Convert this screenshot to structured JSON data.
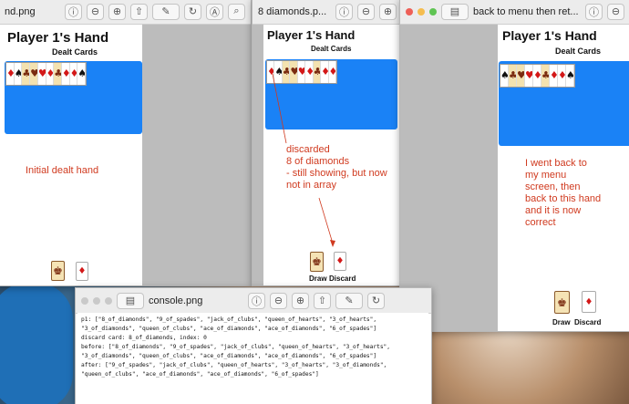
{
  "windows": {
    "left": {
      "title": "nd.png",
      "hand_title": "Player 1's Hand",
      "subtitle": "Dealt Cards",
      "annotation": "Initial dealt hand"
    },
    "middle": {
      "title": "8 diamonds.p...",
      "hand_title": "Player 1's Hand",
      "subtitle": "Dealt Cards",
      "annotation": [
        "discarded",
        "8 of diamonds",
        "- still showing, but now",
        "not in array"
      ],
      "draw_label": "Draw",
      "discard_label": "Discard"
    },
    "right": {
      "title": "back to menu then ret...",
      "hand_title": "Player 1's Hand",
      "subtitle": "Dealt Cards",
      "annotation": [
        "I went back to",
        "my menu",
        "screen, then",
        "back to this hand",
        "and it is now",
        "correct"
      ],
      "draw_label": "Draw",
      "discard_label": "Discard"
    },
    "console": {
      "title": "console.png",
      "lines": [
        "p1: [\"8_of_diamonds\", \"9_of_spades\", \"jack_of_clubs\", \"queen_of_hearts\", \"3_of_hearts\",",
        "    \"3_of_diamonds\", \"queen_of_clubs\", \"ace_of_diamonds\", \"ace_of_diamonds\", \"6_of_spades\"]",
        "discard card: 8_of_diamonds, index: 0",
        "before: [\"8_of_diamonds\", \"9_of_spades\", \"jack_of_clubs\", \"queen_of_hearts\", \"3_of_hearts\",",
        "    \"3_of_diamonds\", \"queen_of_clubs\", \"ace_of_diamonds\", \"ace_of_diamonds\", \"6_of_spades\"]",
        "after: [\"9_of_spades\", \"jack_of_clubs\", \"queen_of_hearts\", \"3_of_hearts\", \"3_of_diamonds\",",
        "    \"queen_of_clubs\", \"ace_of_diamonds\", \"ace_of_diamonds\", \"6_of_spades\"]"
      ]
    }
  },
  "icons": {
    "traffic_close": "#ee5f57",
    "traffic_min": "#f5bd4f",
    "traffic_max": "#5fc453",
    "blue_area": "#1a82f6",
    "annotation_color": "#d03a1f"
  }
}
